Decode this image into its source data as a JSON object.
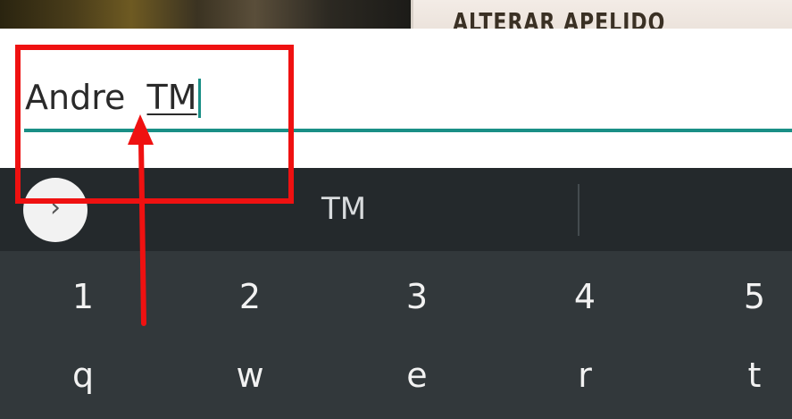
{
  "banner": {
    "title": "ALTERAR APELIDO"
  },
  "input": {
    "committed_text": "Andre  ",
    "composing_text": "TM"
  },
  "suggestions": {
    "items": [
      "TM"
    ]
  },
  "keyboard": {
    "number_row": [
      "1",
      "2",
      "3",
      "4",
      "5"
    ],
    "letter_row": [
      "q",
      "w",
      "e",
      "r",
      "t"
    ]
  },
  "icons": {
    "expand": "chevron-right-icon"
  },
  "colors": {
    "accent": "#1a8f86",
    "annotation": "#ef1111",
    "keyboard_bg": "#32383b",
    "suggestion_bg": "#24292c"
  }
}
